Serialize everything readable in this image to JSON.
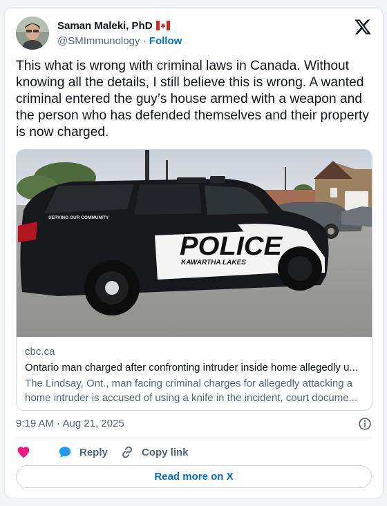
{
  "author": {
    "name": "Saman Maleki, PhD",
    "flag_icon": "canada-flag-icon",
    "handle": "@SMImmunology",
    "separator": "·",
    "follow_label": "Follow"
  },
  "platform_icon": "x-logo-icon",
  "tweet_text": "This what is wrong with criminal laws in Canada. Without knowing all the details, I still believe this is wrong. A wanted criminal entered the guy’s house armed with a weapon and the person who has defended themselves and their property is now charged.",
  "link_card": {
    "image_text": {
      "door_text": "SERVING OUR COMMUNITY",
      "main": "POLICE",
      "sub": "KAWARTHA LAKES"
    },
    "domain": "cbc.ca",
    "title": "Ontario man charged after confronting intruder inside home allegedly u...",
    "description_line1": "The Lindsay, Ont., man facing criminal charges for allegedly attacking a",
    "description_line2": "home intruder is accused of using a knife in the incident, court docume..."
  },
  "timestamp": "9:19 AM · Aug 21, 2025",
  "actions": {
    "like_icon": "heart-icon",
    "reply_label": "Reply",
    "copy_label": "Copy link"
  },
  "read_more_label": "Read more on X",
  "colors": {
    "accent": "#006fd6",
    "like": "#f91880",
    "reply": "#1d9bf0",
    "text_primary": "#0f1419",
    "text_secondary": "#536471"
  }
}
